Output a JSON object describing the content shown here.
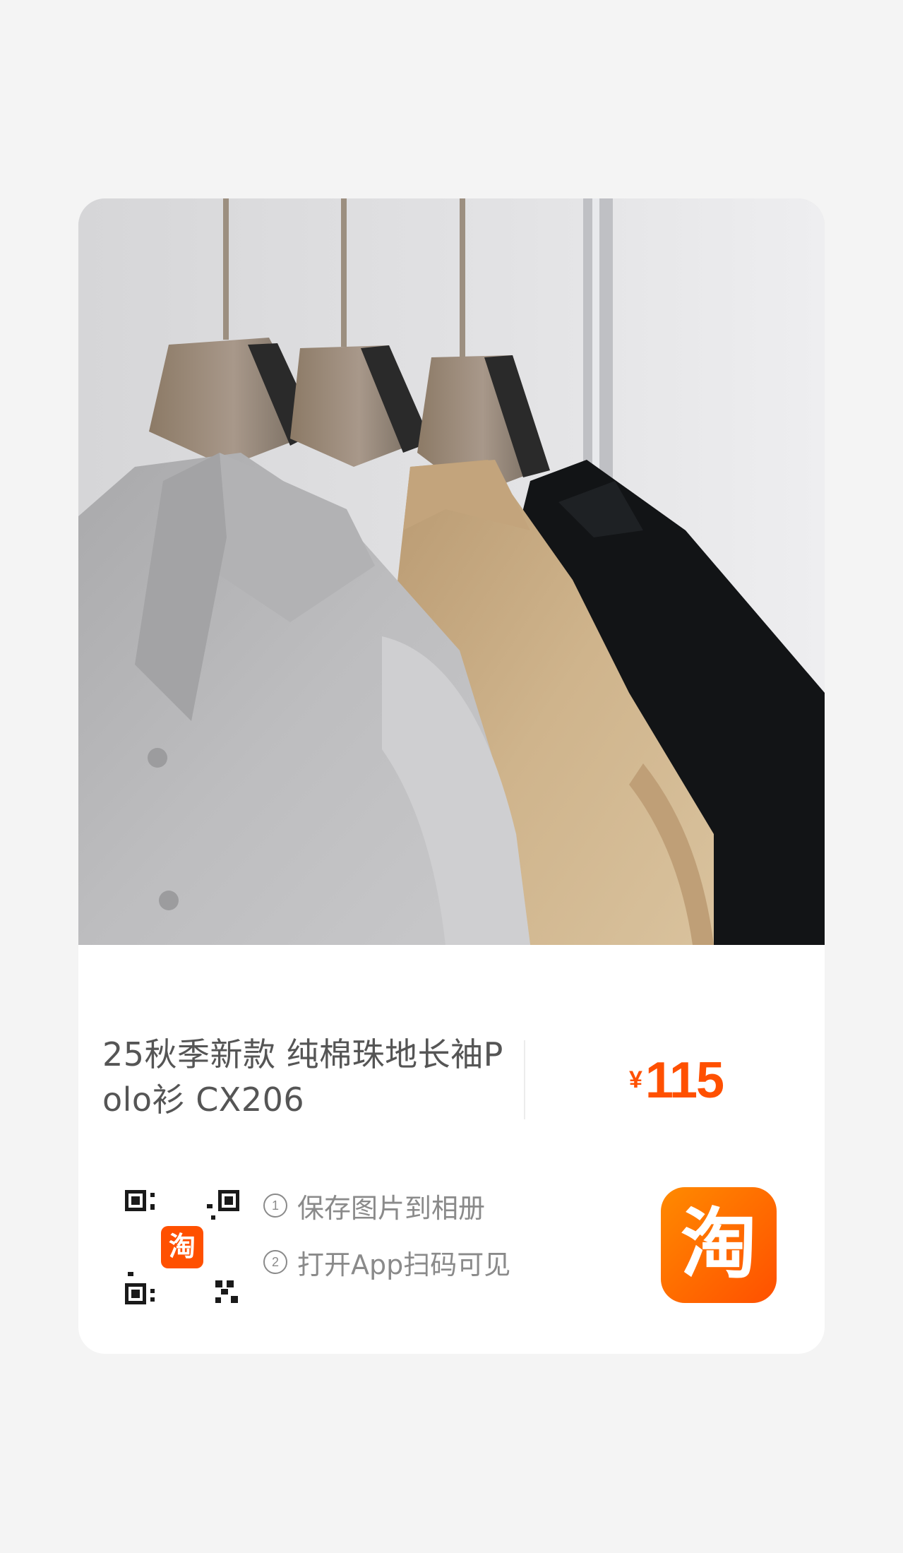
{
  "product": {
    "image_icon": "product-photo-polo-shirts",
    "title": "25秋季新款 纯棉珠地长袖Polo衫 CX206",
    "price_currency": "¥",
    "price_value": "115"
  },
  "steps": [
    {
      "num": "1",
      "text": "保存图片到相册"
    },
    {
      "num": "2",
      "text": "打开App扫码可见"
    }
  ],
  "qr": {
    "center_badge_glyph": "淘"
  },
  "logo": {
    "glyph": "淘",
    "icon": "taobao-app-icon"
  },
  "colors": {
    "accent": "#ff5000",
    "text_primary": "#555555",
    "text_secondary": "#8a8a8a",
    "background": "#f4f4f4",
    "card": "#ffffff"
  }
}
